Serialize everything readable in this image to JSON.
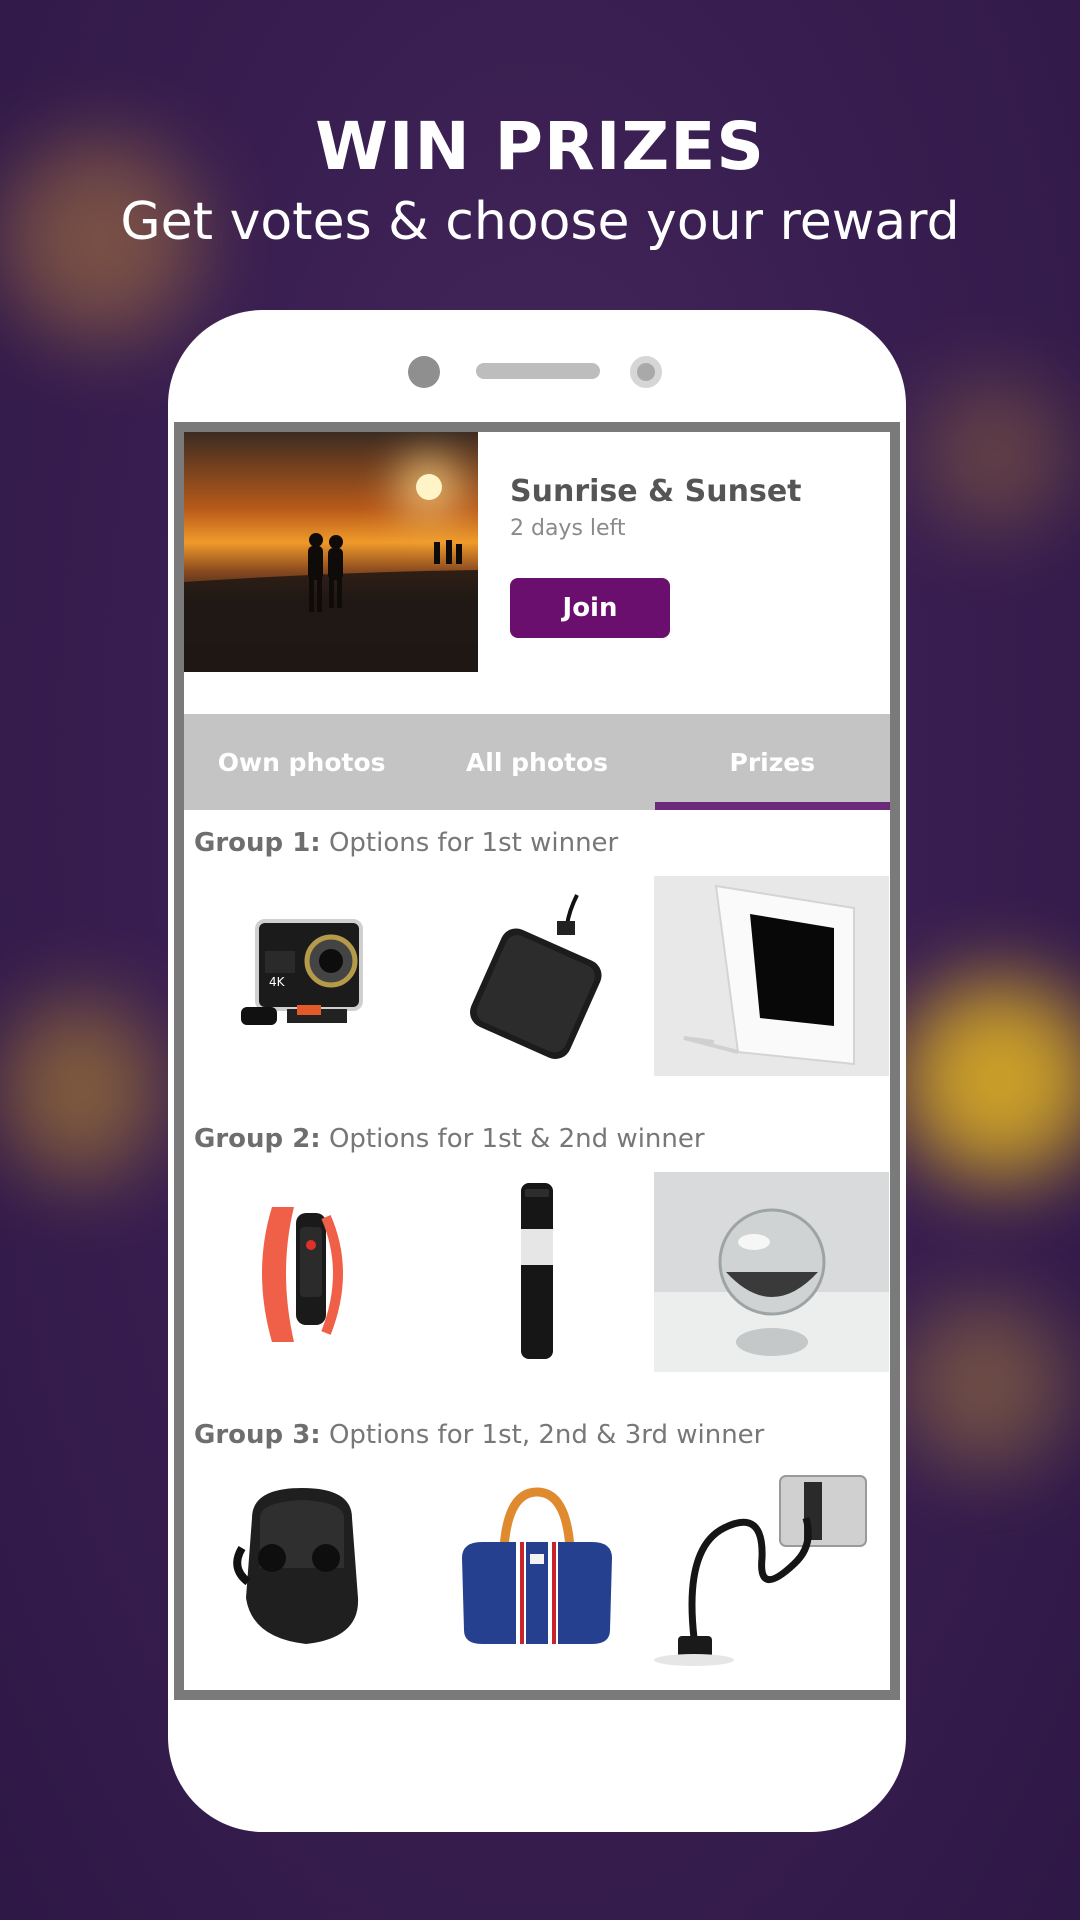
{
  "header": {
    "title": "WIN PRIZES",
    "subtitle": "Get votes & choose your reward"
  },
  "challenge": {
    "title": "Sunrise & Sunset",
    "time_left": "2 days left",
    "join_label": "Join"
  },
  "tabs": [
    {
      "label": "Own photos",
      "active": false
    },
    {
      "label": "All photos",
      "active": false
    },
    {
      "label": "Prizes",
      "active": true
    }
  ],
  "groups": [
    {
      "name": "Group 1:",
      "description": "Options for 1st winner",
      "prizes": [
        "action-camera-icon",
        "external-hard-drive-icon",
        "digital-photo-frame-icon"
      ]
    },
    {
      "name": "Group 2:",
      "description": "Options for 1st & 2nd winner",
      "prizes": [
        "fitness-band-icon",
        "travel-coffee-press-icon",
        "lens-ball-icon"
      ]
    },
    {
      "name": "Group 3:",
      "description": "Options for 1st, 2nd & 3rd winner",
      "prizes": [
        "wireless-earbuds-icon",
        "duffel-bag-icon",
        "flexible-phone-holder-icon"
      ]
    }
  ],
  "colors": {
    "background": "#3a1f52",
    "accent": "#6b0f6f",
    "tab_bar": "#c4c4c4",
    "tab_indicator": "#6b2a7a",
    "bezel": "#7a7a7a"
  }
}
